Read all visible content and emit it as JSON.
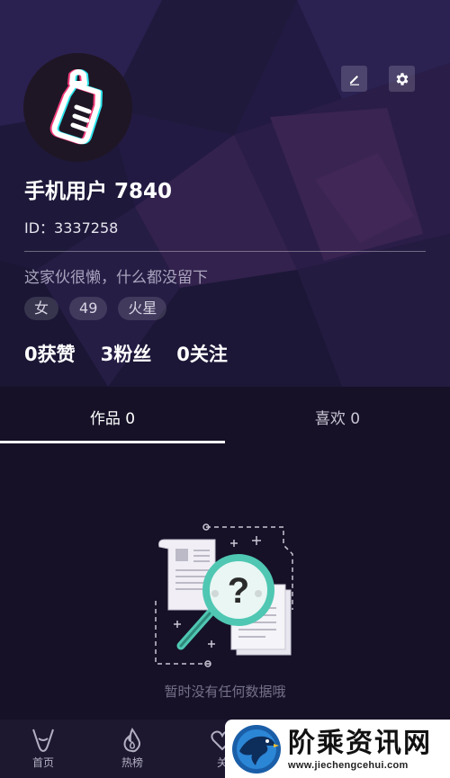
{
  "profile": {
    "nickname": "手机用户 7840",
    "id_text": "ID：3337258",
    "bio": "这家伙很懒，什么都没留下",
    "tags": [
      "女",
      "49",
      "火星"
    ],
    "stats": [
      "0获赞",
      "3粉丝",
      "0关注"
    ]
  },
  "toolbar": {
    "edit_icon": "pencil-icon",
    "settings_icon": "gear-icon"
  },
  "tabs": {
    "works": "作品 0",
    "likes": "喜欢 0"
  },
  "empty_state": {
    "message": "暂时没有任何数据哦",
    "icon": "document-search-icon"
  },
  "bottom_nav": {
    "items": [
      {
        "label": "首页",
        "icon": "home-icon"
      },
      {
        "label": "热榜",
        "icon": "flame-icon"
      },
      {
        "label": "关",
        "icon": "heart-icon"
      }
    ]
  },
  "watermark": {
    "name": "阶乘资讯网",
    "url": "www.jiechengcehui.com"
  },
  "colors": {
    "background": "#161127",
    "header": "#241c45",
    "accent_teal": "#4fc7b3",
    "avatar_pink": "#f23c7a",
    "avatar_cyan": "#2fe6ee"
  }
}
